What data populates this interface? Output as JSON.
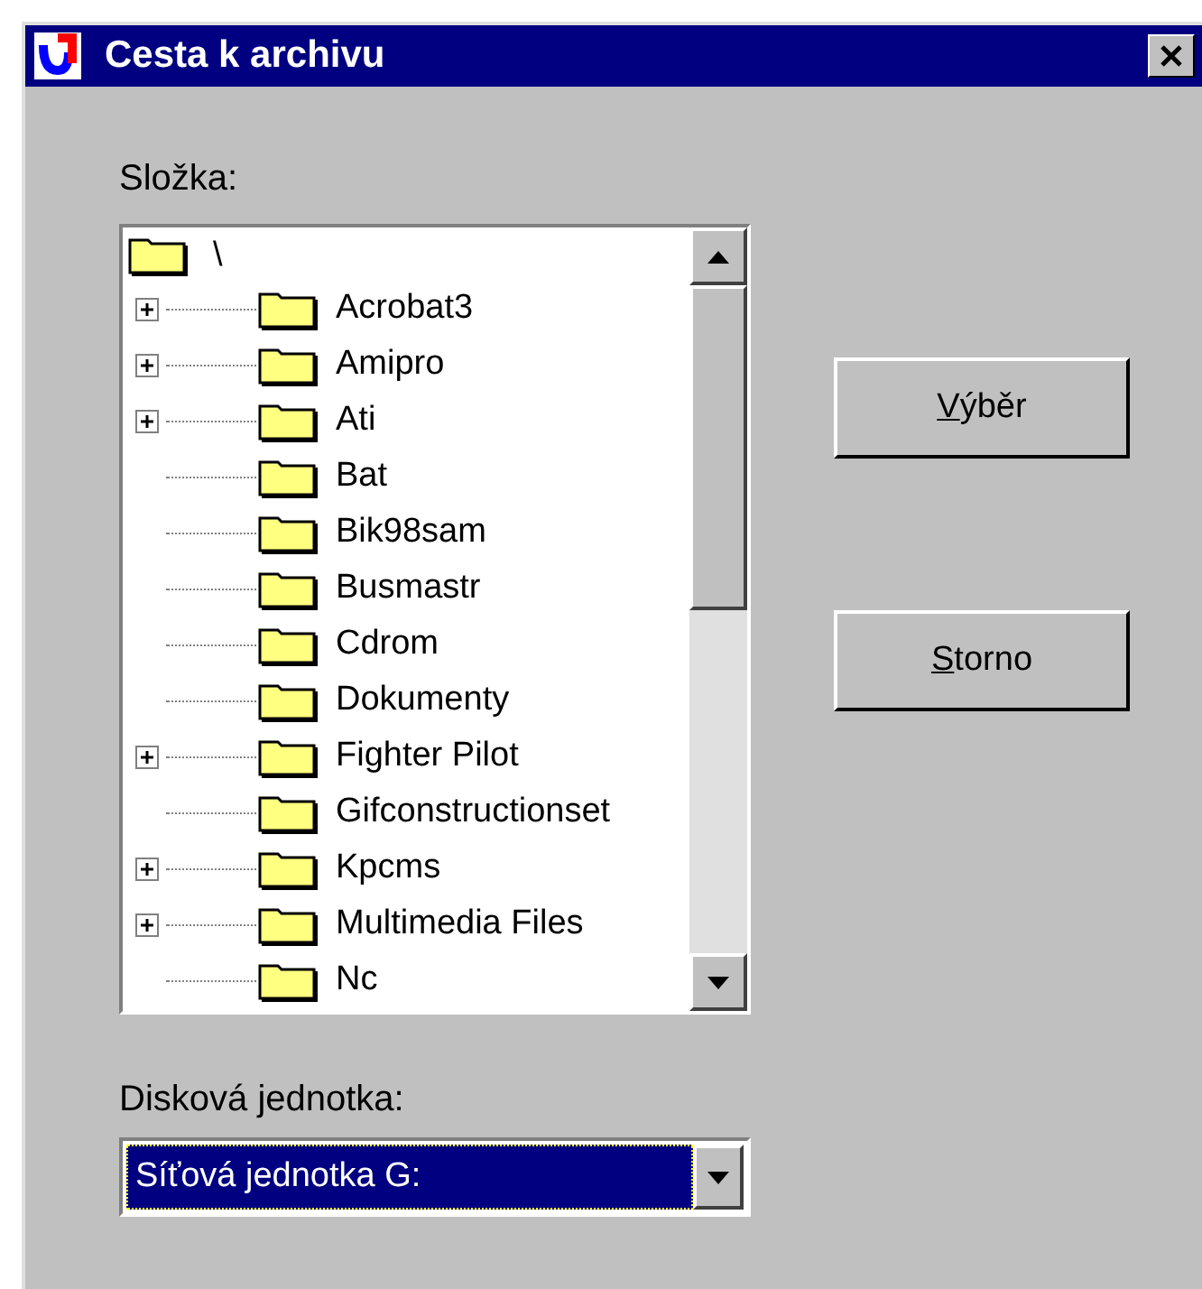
{
  "window": {
    "title": "Cesta k archivu"
  },
  "folder_label": "Složka:",
  "tree": {
    "root": "\\",
    "children": [
      {
        "name": "Acrobat3",
        "expandable": true
      },
      {
        "name": "Amipro",
        "expandable": true
      },
      {
        "name": "Ati",
        "expandable": true
      },
      {
        "name": "Bat",
        "expandable": false
      },
      {
        "name": "Bik98sam",
        "expandable": false
      },
      {
        "name": "Busmastr",
        "expandable": false
      },
      {
        "name": "Cdrom",
        "expandable": false
      },
      {
        "name": "Dokumenty",
        "expandable": false
      },
      {
        "name": "Fighter Pilot",
        "expandable": true
      },
      {
        "name": "Gifconstructionset",
        "expandable": false
      },
      {
        "name": "Kpcms",
        "expandable": true
      },
      {
        "name": "Multimedia Files",
        "expandable": true
      },
      {
        "name": "Nc",
        "expandable": false
      }
    ]
  },
  "buttons": [
    {
      "label": "Výběr"
    },
    {
      "label": "Storno"
    }
  ],
  "drive_label": "Disková jednotka:",
  "drive_select": {
    "value": "Síťová jednotka G:"
  }
}
